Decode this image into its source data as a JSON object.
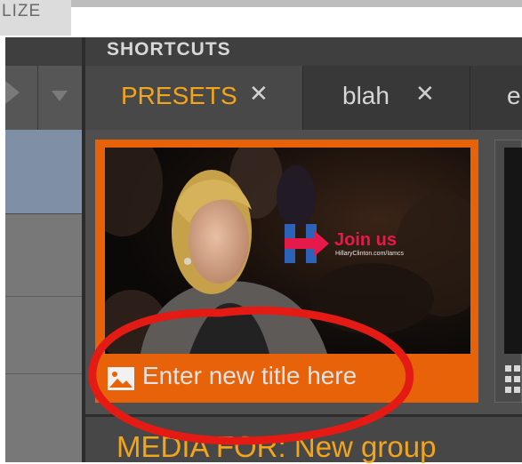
{
  "top": {
    "left_tab_label": "LIZE"
  },
  "shortcuts": {
    "title": "SHORTCUTS"
  },
  "tabs": [
    {
      "label": "PRESETS",
      "close": "✕",
      "active": true
    },
    {
      "label": "blah",
      "close": "✕",
      "active": false
    },
    {
      "label": "e",
      "close": "",
      "active": false
    }
  ],
  "card": {
    "title_placeholder": "Enter new title here",
    "image": {
      "headline": "Join us",
      "url": "HillaryClinton.com/Iamcs"
    }
  },
  "media": {
    "prefix": "MEDIA FOR: ",
    "group": "New group"
  },
  "colors": {
    "accent_orange": "#e8620a",
    "tab_active_text": "#f2a51b",
    "annotation_red": "#e41a14",
    "logo_red": "#e6194b",
    "logo_blue": "#2c63b8"
  }
}
